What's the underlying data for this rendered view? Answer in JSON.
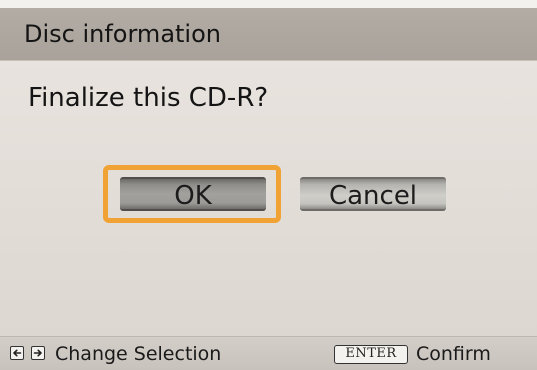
{
  "dialog": {
    "title": "Disc information",
    "question": "Finalize this CD-R?"
  },
  "buttons": {
    "ok_label": "OK",
    "cancel_label": "Cancel",
    "focused": "OK"
  },
  "footer": {
    "left_icon": "left-arrow-key-icon",
    "right_icon": "right-arrow-key-icon",
    "change_selection_label": "Change Selection",
    "enter_key_label": "ENTER",
    "confirm_label": "Confirm"
  },
  "colors": {
    "title_bar": "#aca59e",
    "background": "#e4dfd9",
    "focus_ring": "#f0a234",
    "footer": "#cdc8c2"
  }
}
